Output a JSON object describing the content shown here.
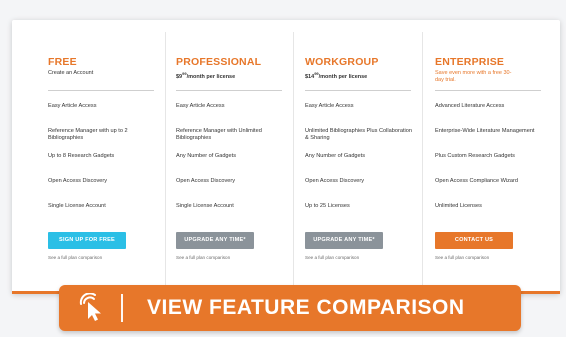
{
  "colors": {
    "accent": "#e7772a",
    "blue": "#2bbfe6",
    "gray": "#8b939a"
  },
  "plans": [
    {
      "name": "FREE",
      "subtitle_parts": [
        "Create an Account"
      ],
      "features": [
        "Easy Article Access",
        "Reference Manager with up to 2 Bibliographies",
        "Up to 8 Research Gadgets",
        "Open Access Discovery",
        "Single License Account"
      ],
      "cta": "SIGN UP FOR FREE",
      "compare": "See a full plan comparison"
    },
    {
      "name": "PROFESSIONAL",
      "price_main": "$9",
      "price_sup": "99",
      "price_suffix": "/month per license",
      "features": [
        "Easy Article Access",
        "Reference Manager with Unlimited Bibliographies",
        "Any Number of Gadgets",
        "Open Access Discovery",
        "Single License Account"
      ],
      "cta": "UPGRADE ANY TIME*",
      "compare": "See a full plan comparison"
    },
    {
      "name": "WORKGROUP",
      "price_main": "$14",
      "price_sup": "99",
      "price_suffix": "/month per license",
      "features": [
        "Easy Article Access",
        "Unlimited Bibliographies Plus Collaboration & Sharing",
        "Any Number of Gadgets",
        "Open Access Discovery",
        "Up to 25 Licenses"
      ],
      "cta": "UPGRADE ANY TIME*",
      "compare": "See a full plan comparison"
    },
    {
      "name": "ENTERPRISE",
      "subtitle": "Save even more with a free 30-day trial.",
      "features": [
        "Advanced Literature Access",
        "Enterprise-Wide Literature Management",
        "Plus Custom Research Gadgets",
        "Open Access Compliance Wizard",
        "Unlimited Licenses"
      ],
      "cta": "CONTACT US",
      "compare": "See a full plan comparison"
    }
  ],
  "banner": {
    "label": "VIEW FEATURE COMPARISON",
    "icon": "click-pointer-icon"
  }
}
